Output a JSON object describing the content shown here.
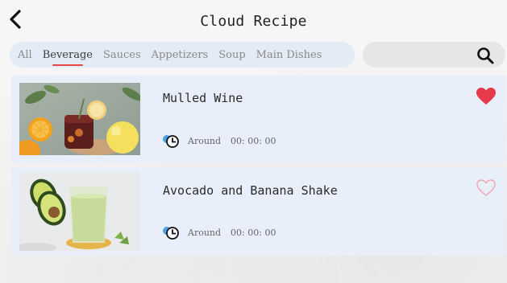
{
  "header": {
    "title": "Cloud Recipe"
  },
  "tabs": [
    {
      "label": "All",
      "active": false
    },
    {
      "label": "Beverage",
      "active": true
    },
    {
      "label": "Sauces",
      "active": false
    },
    {
      "label": "Appetizers",
      "active": false
    },
    {
      "label": "Soup",
      "active": false
    },
    {
      "label": "Main Dishes",
      "active": false
    }
  ],
  "search": {
    "value": "",
    "placeholder": "",
    "icon": "search-icon"
  },
  "recipes": [
    {
      "name": "Mulled Wine",
      "time_prefix": "Around",
      "time": "00: 00: 00",
      "favorited": true,
      "image": "mulled-wine-photo"
    },
    {
      "name": "Avocado and Banana Shake",
      "time_prefix": "Around",
      "time": "00: 00: 00",
      "favorited": false,
      "image": "avocado-shake-photo"
    }
  ],
  "colors": {
    "accent_red": "#e63a4a",
    "tab_bar": "#e3ebf7",
    "card_bg": "#e9eefb",
    "clock_blue": "#4aa3e8"
  }
}
